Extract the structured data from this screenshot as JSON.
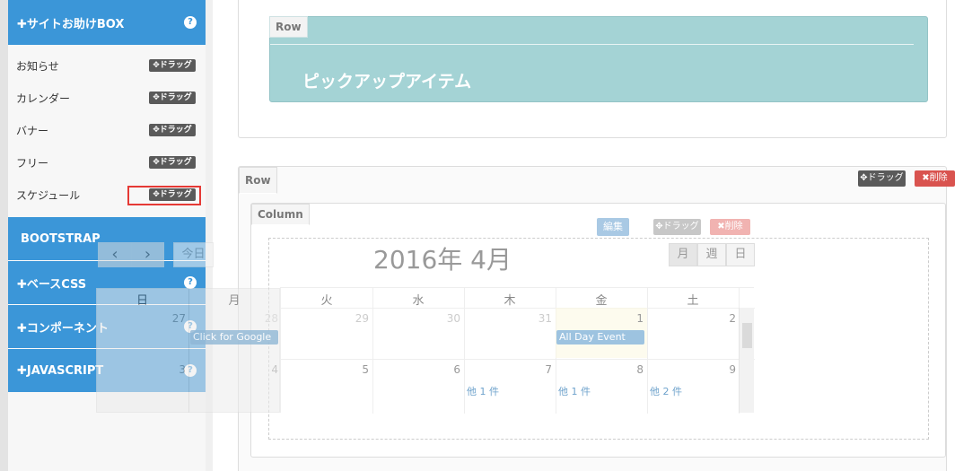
{
  "sidebar": {
    "site_help": {
      "label": "✚サイトお助けBOX",
      "help": "?"
    },
    "items": [
      {
        "label": "お知らせ",
        "drag": "✥ドラッグ"
      },
      {
        "label": "カレンダー",
        "drag": "✥ドラッグ"
      },
      {
        "label": "バナー",
        "drag": "✥ドラッグ"
      },
      {
        "label": "フリー",
        "drag": "✥ドラッグ"
      },
      {
        "label": "スケジュール",
        "drag": "✥ドラッグ"
      }
    ],
    "bootstrap": "BOOTSTRAP",
    "base_css": {
      "label": "✚ベースCSS",
      "help": "?"
    },
    "component": {
      "label": "✚コンポーネント",
      "help": "?"
    },
    "javascript": {
      "label": "✚JAVASCRIPT",
      "help": "?"
    }
  },
  "top_row": {
    "row_tab": "Row",
    "banner_text": "ピックアップアイテム"
  },
  "second_row": {
    "row_tab": "Row",
    "drag": "✥ドラッグ",
    "delete": "✖削除",
    "column_tab": "Column",
    "edit": "編集",
    "col_drag": "✥ドラッグ",
    "col_delete": "✖削除"
  },
  "calendar": {
    "title": "2016年 4月",
    "nav_prev": "‹",
    "nav_next": "›",
    "today": "今日",
    "views": [
      "月",
      "週",
      "日"
    ],
    "weekdays": [
      "日",
      "月",
      "火",
      "水",
      "木",
      "金",
      "土"
    ],
    "week1": [
      "27",
      "28",
      "29",
      "30",
      "31",
      "1",
      "2"
    ],
    "week2": [
      "3",
      "4",
      "5",
      "6",
      "7",
      "8",
      "9"
    ],
    "events": {
      "google": "Click for Google",
      "all_day": "All Day Event"
    },
    "more": [
      "他 1 件",
      "他 1 件",
      "他 2 件"
    ]
  },
  "colors": {
    "sidebar_blue": "#3b96d8",
    "banner_teal": "#a4d3d5",
    "delete_red": "#d9534f"
  }
}
